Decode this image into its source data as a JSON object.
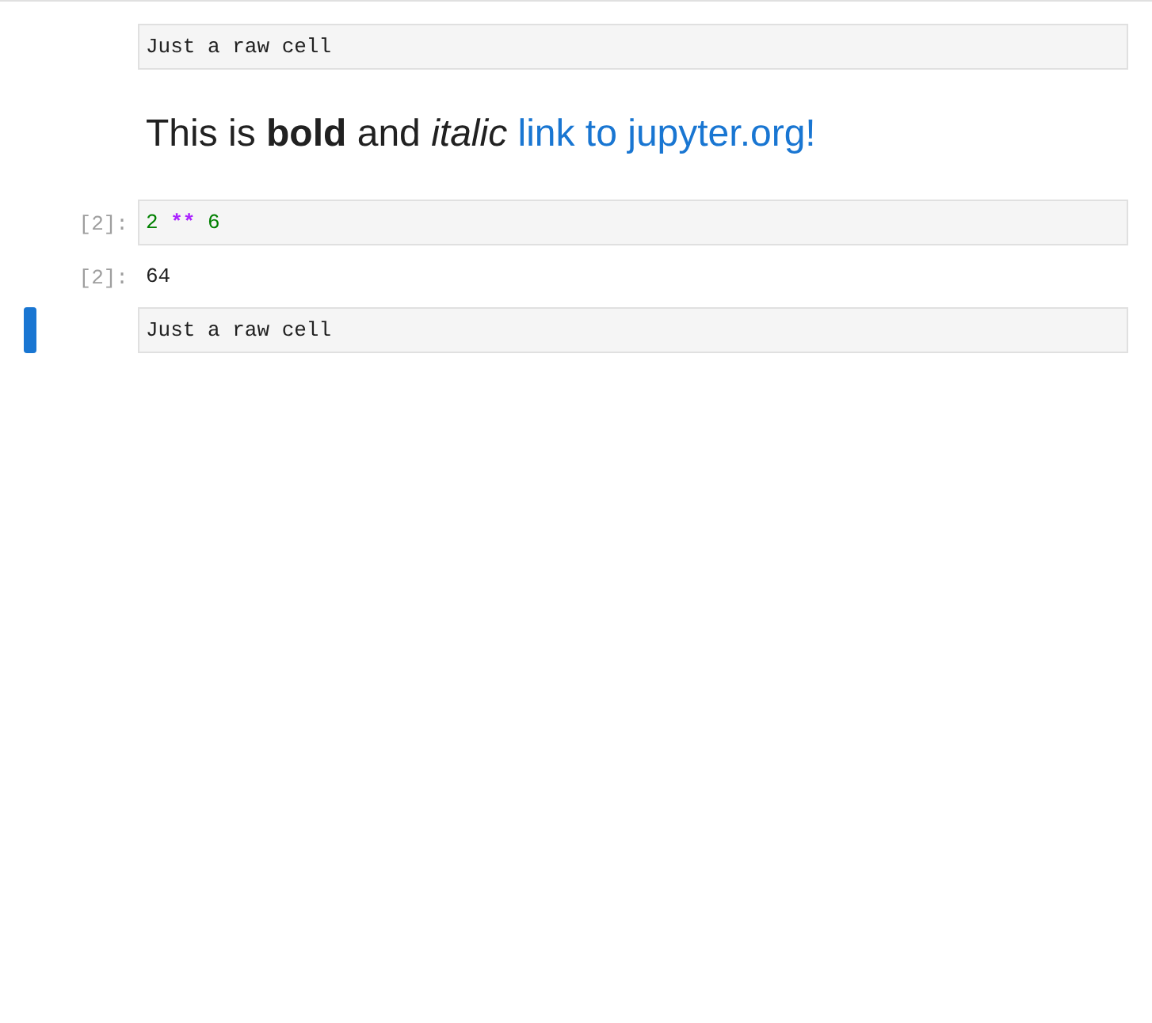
{
  "cells": [
    {
      "kind": "raw",
      "selected": false,
      "text": "Just a raw cell"
    },
    {
      "kind": "markdown",
      "selected": false,
      "text": "This is **bold** and *italic*",
      "link": "link to jupyter.org!"
    },
    {
      "kind": "code",
      "selected": false,
      "prompt": "[2]:",
      "tokens": [
        {
          "kind": "number",
          "text": "2"
        },
        {
          "kind": "operator",
          "text": "**"
        },
        {
          "kind": "number",
          "text": "6"
        }
      ]
    },
    {
      "kind": "output",
      "selected": false,
      "prompt": "[2]:",
      "text": "64"
    },
    {
      "kind": "raw",
      "selected": true,
      "text": "Just a raw cell"
    }
  ]
}
